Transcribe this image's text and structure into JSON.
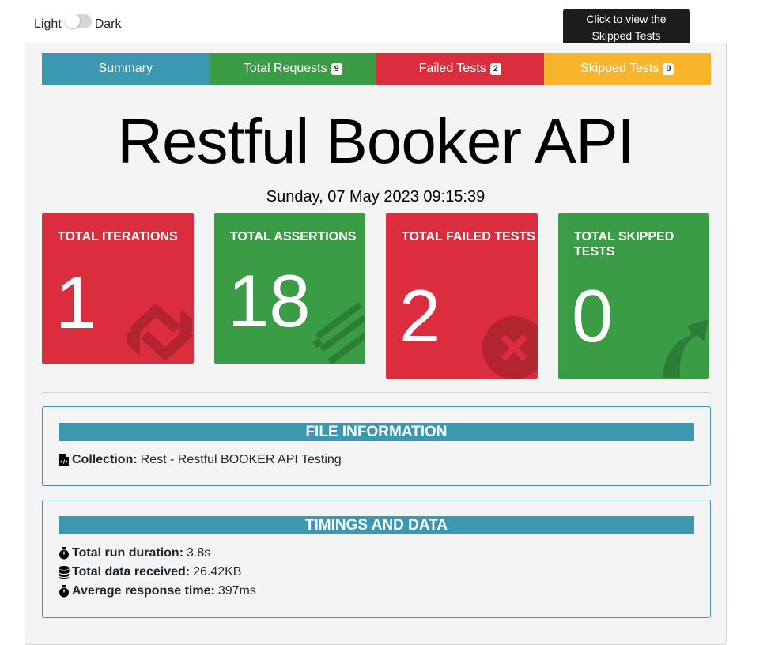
{
  "theme": {
    "light_label": "Light",
    "dark_label": "Dark"
  },
  "tooltip": {
    "text": "Click to view the Skipped Tests"
  },
  "tabs": [
    {
      "label": "Summary",
      "badge": null,
      "color": "#3b98b0"
    },
    {
      "label": "Total Requests",
      "badge": "9",
      "color": "#3a9c45"
    },
    {
      "label": "Failed Tests",
      "badge": "2",
      "color": "#dc2d3e"
    },
    {
      "label": "Skipped Tests",
      "badge": "0",
      "color": "#f7b52b"
    }
  ],
  "title": "Restful Booker API",
  "date": "Sunday, 07 May 2023 09:15:39",
  "cards": [
    {
      "title": "TOTAL ITERATIONS",
      "value": "1",
      "color": "#dc2d3e",
      "icon": "sync-icon"
    },
    {
      "title": "TOTAL ASSERTIONS",
      "value": "18",
      "color": "#3a9c45",
      "icon": "list-lines-icon"
    },
    {
      "title": "TOTAL FAILED TESTS",
      "value": "2",
      "color": "#dc2d3e",
      "icon": "times-circle-icon"
    },
    {
      "title": "TOTAL SKIPPED TESTS",
      "value": "0",
      "color": "#3a9c45",
      "icon": "share-arrow-icon"
    }
  ],
  "file_info": {
    "header": "FILE INFORMATION",
    "collection_label": "Collection:",
    "collection_value": "Rest - Restful BOOKER API Testing"
  },
  "timings": {
    "header": "TIMINGS AND DATA",
    "rows": [
      {
        "label": "Total run duration:",
        "value": "3.8s",
        "icon": "stopwatch-icon"
      },
      {
        "label": "Total data received:",
        "value": "26.42KB",
        "icon": "database-icon"
      },
      {
        "label": "Average response time:",
        "value": "397ms",
        "icon": "stopwatch-icon"
      }
    ]
  }
}
